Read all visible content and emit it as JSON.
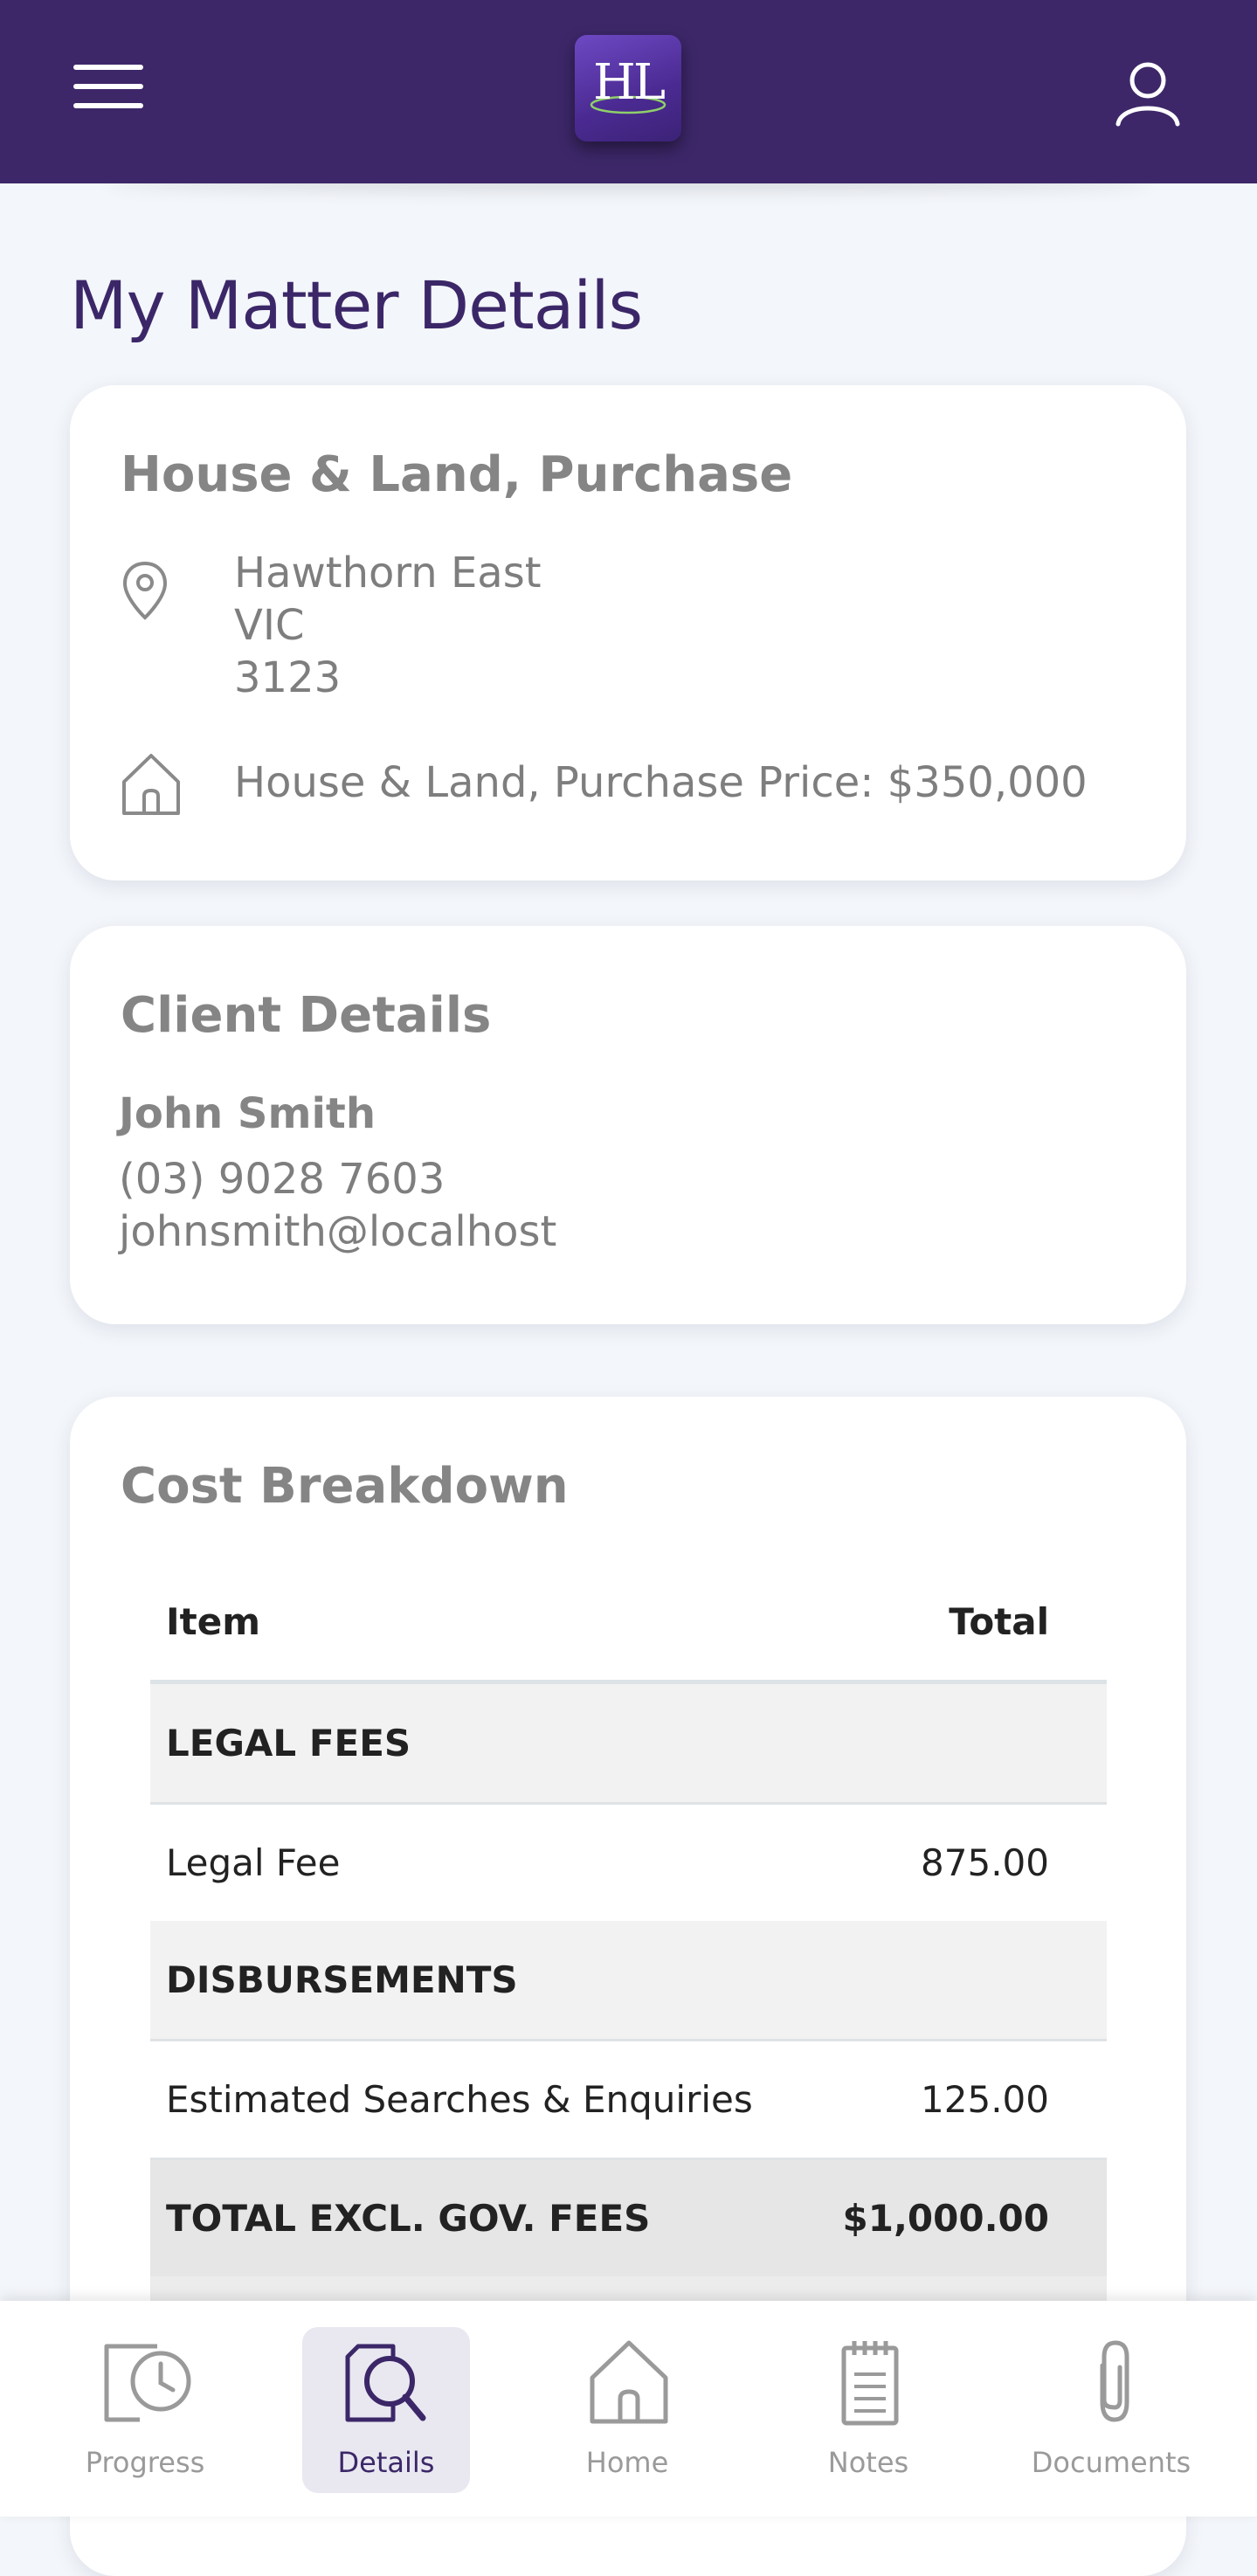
{
  "header": {
    "logo_text": "HL",
    "menu_icon": "hamburger-menu-icon",
    "user_icon": "user-profile-icon"
  },
  "page": {
    "title": "My Matter Details"
  },
  "matter": {
    "title": "House & Land, Purchase",
    "address_lines": [
      "Hawthorn East",
      "VIC",
      "3123"
    ],
    "price_line": "House & Land, Purchase Price: $350,000",
    "location_icon": "location-pin-icon",
    "property_icon": "house-icon"
  },
  "client": {
    "title": "Client Details",
    "name": "John Smith",
    "phone": "(03) 9028 7603",
    "email": "johnsmith@localhost"
  },
  "costs": {
    "title": "Cost Breakdown",
    "headers": [
      "Item",
      "Total"
    ],
    "rows": [
      {
        "type": "section",
        "label": "LEGAL FEES",
        "value": ""
      },
      {
        "type": "row",
        "label": "Legal Fee",
        "value": "875.00"
      },
      {
        "type": "section",
        "label": "DISBURSEMENTS",
        "value": ""
      },
      {
        "type": "row",
        "label": "Estimated Searches & Enquiries",
        "value": "125.00"
      },
      {
        "type": "total",
        "label": "TOTAL EXCL. GOV. FEES",
        "value": "$1,000.00"
      }
    ]
  },
  "nav": {
    "items": [
      {
        "label": "Progress",
        "icon": "progress-clock-icon",
        "active": false
      },
      {
        "label": "Details",
        "icon": "details-search-icon",
        "active": true
      },
      {
        "label": "Home",
        "icon": "home-icon",
        "active": false
      },
      {
        "label": "Notes",
        "icon": "notes-icon",
        "active": false
      },
      {
        "label": "Documents",
        "icon": "paperclip-icon",
        "active": false
      }
    ]
  },
  "colors": {
    "header_bg": "#3d2769",
    "accent": "#3b2768",
    "page_bg": "#f3f6fa"
  }
}
